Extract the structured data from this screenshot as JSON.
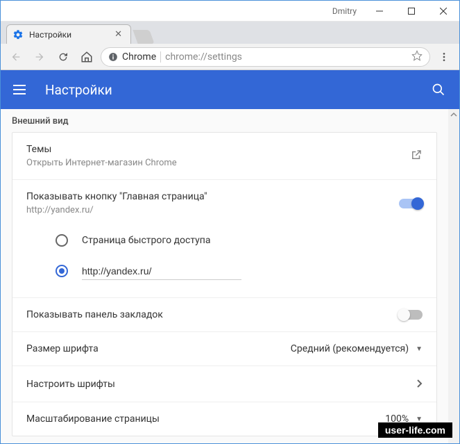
{
  "titlebar": {
    "user": "Dmitry"
  },
  "tab": {
    "title": "Настройки"
  },
  "omnibox": {
    "scheme": "Chrome",
    "url": "chrome://settings"
  },
  "header": {
    "title": "Настройки"
  },
  "section": {
    "label": "Внешний вид"
  },
  "appearance": {
    "themes": {
      "title": "Темы",
      "sub": "Открыть Интернет-магазин Chrome"
    },
    "home_button": {
      "title": "Показывать кнопку \"Главная страница\"",
      "sub": "http://yandex.ru/",
      "radio_quick": "Страница быстрого доступа",
      "radio_url_value": "http://yandex.ru/"
    },
    "bookmarks_bar": {
      "title": "Показывать панель закладок"
    },
    "font_size": {
      "title": "Размер шрифта",
      "value": "Средний (рекомендуется)"
    },
    "customize_fonts": {
      "title": "Настроить шрифты"
    },
    "page_zoom": {
      "title": "Масштабирование страницы",
      "value": "100%"
    }
  },
  "watermark": "user-life.com"
}
